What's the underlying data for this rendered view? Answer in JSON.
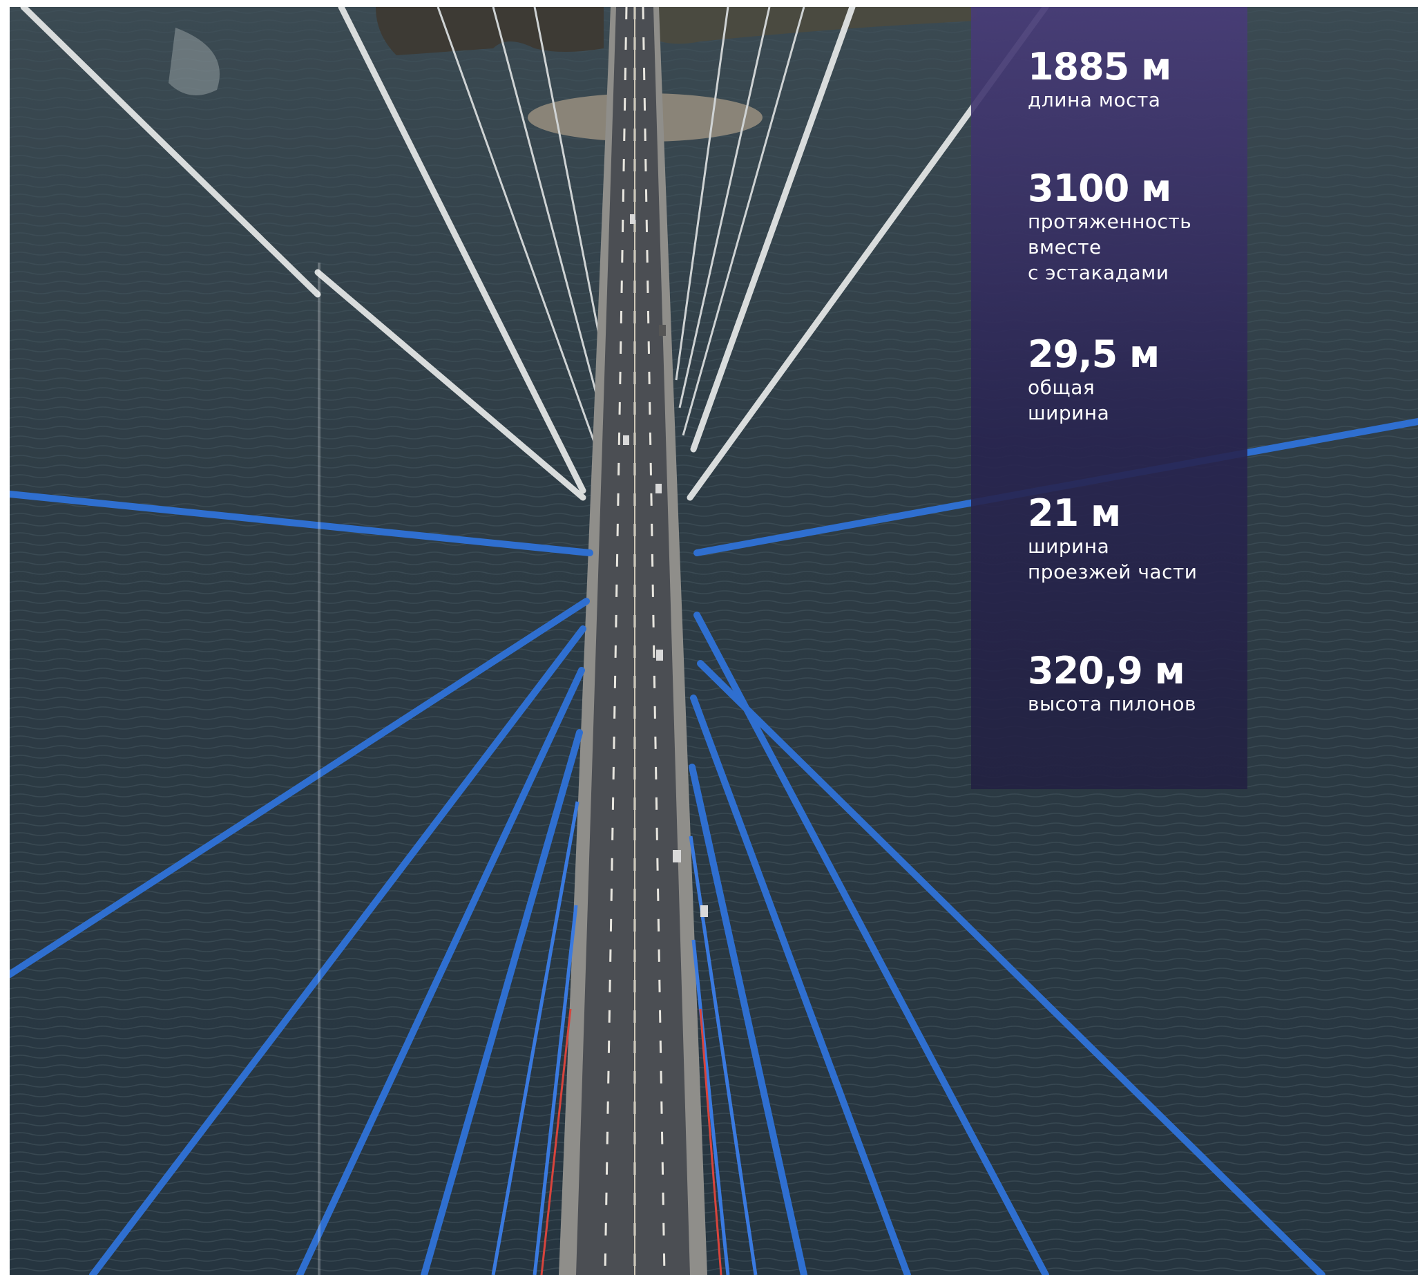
{
  "stats": [
    {
      "value": "1885 м",
      "label": "длина моста"
    },
    {
      "value": "3100 м",
      "label": "протяженность\nвместе\nс эстакадами"
    },
    {
      "value": "29,5 м",
      "label": "общая\nширина"
    },
    {
      "value": "21 м",
      "label": "ширина\nпроезжей части"
    },
    {
      "value": "320,9 м",
      "label": "высота пилонов"
    }
  ],
  "colors": {
    "water": "#2e3c45",
    "cable_blue": "#2f6fd0",
    "cable_white": "#d8dcdc",
    "deck": "#4a4d52",
    "panel": "#3a3270"
  }
}
